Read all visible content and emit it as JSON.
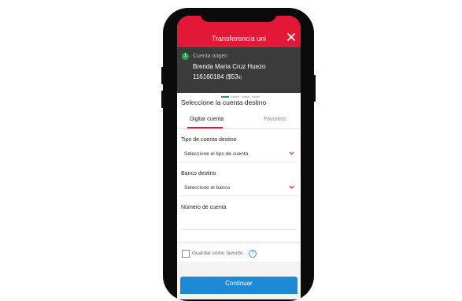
{
  "header": {
    "title": "Transferencia uni"
  },
  "origin": {
    "step": "1",
    "label": "Cuenta origen",
    "name": "Brenda Maria Cruz Huezo",
    "account": "116160184",
    "amount": "($53",
    "currency": "¢)"
  },
  "main": {
    "section_title": "Seleccione la cuenta destino",
    "tabs": [
      {
        "label": "Digitar cuenta",
        "active": true
      },
      {
        "label": "Favoritos",
        "active": false
      }
    ],
    "account_type": {
      "label": "Tipo de cuenta destino",
      "value": "Seleccione el tipo de cuenta"
    },
    "bank": {
      "label": "Banco destino",
      "value": "Seleccione el banco"
    },
    "account_number": {
      "label": "Número de cuenta",
      "value": ""
    },
    "favorite": {
      "label": "Guardar como favorito",
      "checked": false
    },
    "continue_label": "Continuar"
  },
  "colors": {
    "brand_red": "#e31837",
    "origin_bg": "#3b3b3b",
    "step_green": "#2aa84a",
    "button_blue": "#1e8ad6"
  }
}
